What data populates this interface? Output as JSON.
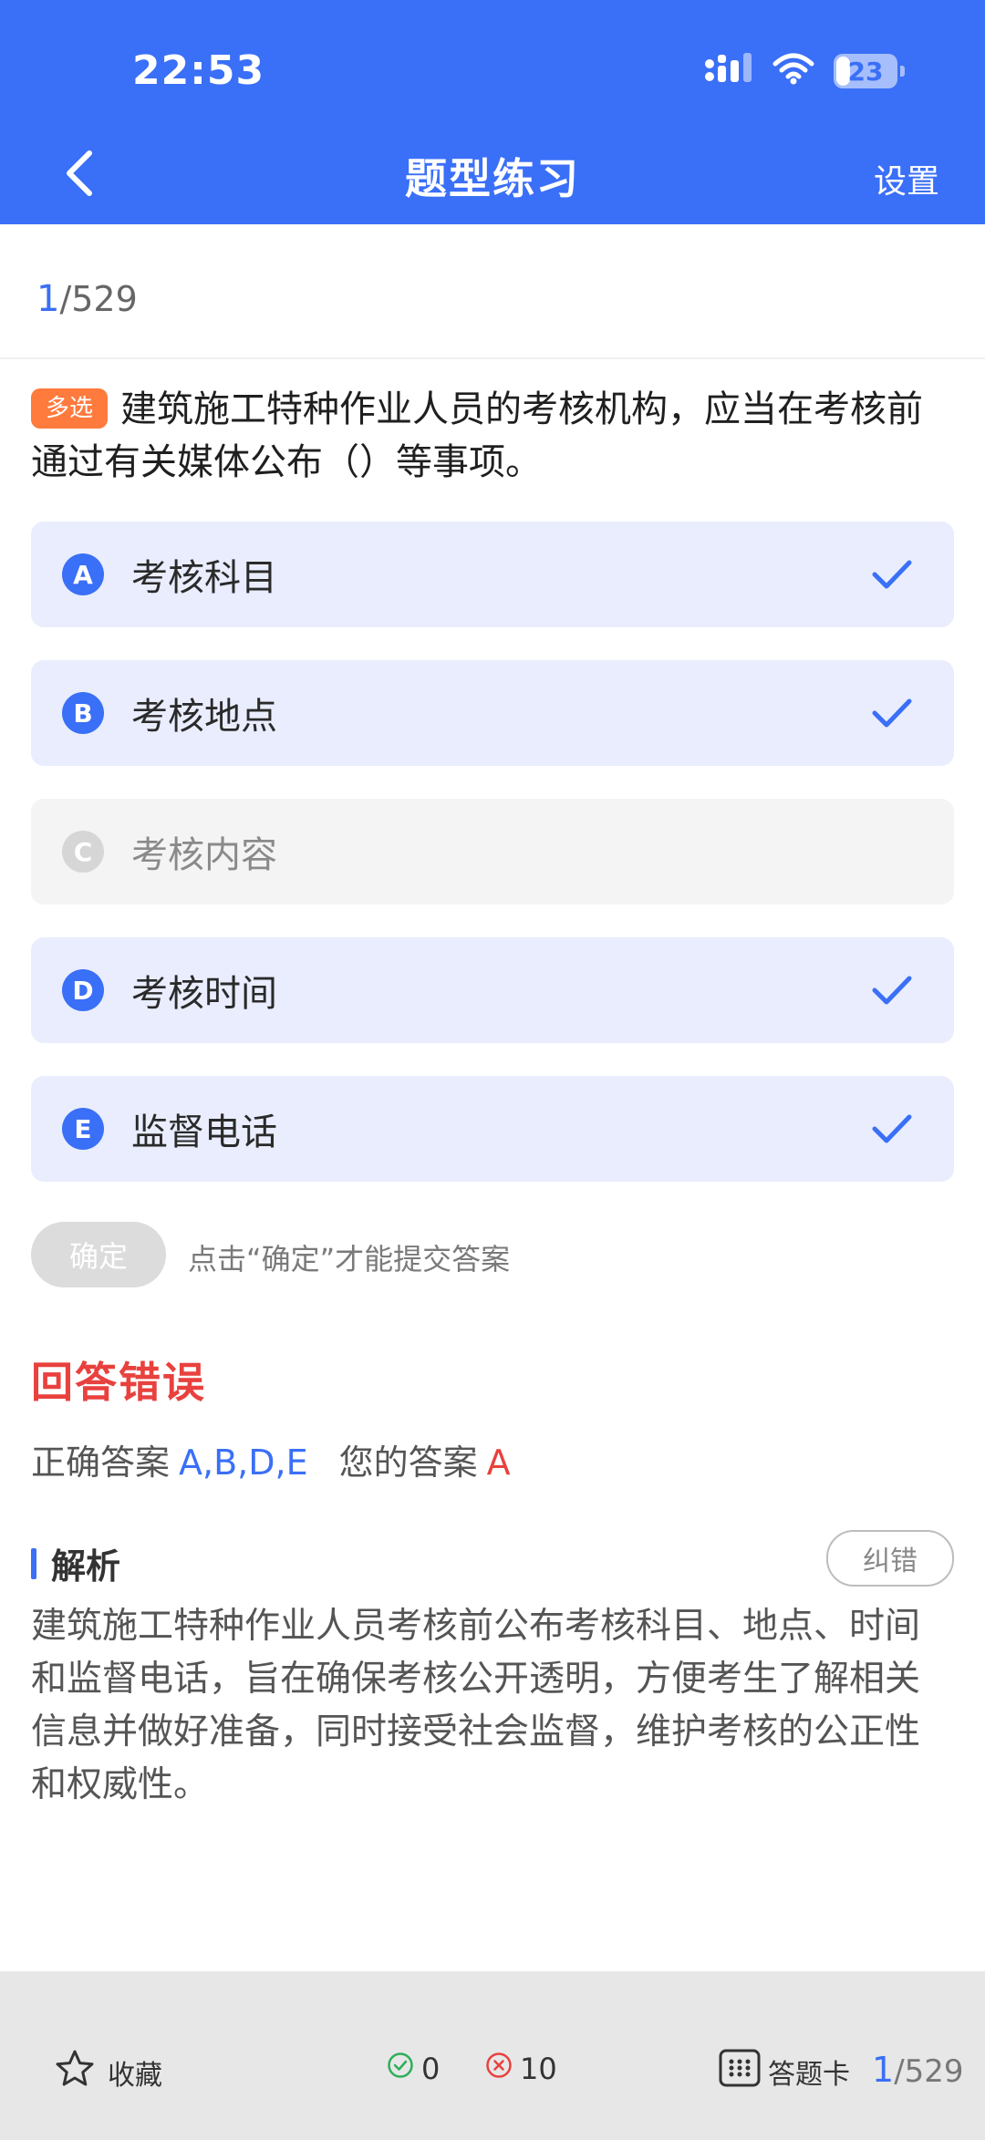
{
  "status_bar": {
    "time": "22:53",
    "battery": "23",
    "battery_level": 0.23
  },
  "nav": {
    "title": "题型练习",
    "settings_label": "设置"
  },
  "progress": {
    "current": "1",
    "total": "/529"
  },
  "question": {
    "type_badge": "多选",
    "text": "建筑施工特种作业人员的考核机构，应当在考核前通过有关媒体公布（）等事项。"
  },
  "options": [
    {
      "letter": "A",
      "text": "考核科目",
      "selected": true
    },
    {
      "letter": "B",
      "text": "考核地点",
      "selected": true
    },
    {
      "letter": "C",
      "text": "考核内容",
      "selected": false
    },
    {
      "letter": "D",
      "text": "考核时间",
      "selected": true
    },
    {
      "letter": "E",
      "text": "监督电话",
      "selected": true
    }
  ],
  "confirm": {
    "button_label": "确定",
    "hint": "点击“确定”才能提交答案"
  },
  "result": {
    "title": "回答错误",
    "correct_label": "正确答案",
    "correct_value": "A,B,D,E",
    "your_label": "您的答案",
    "your_value": "A"
  },
  "analysis": {
    "label": "解析",
    "report_button": "纠错",
    "text": "建筑施工特种作业人员考核前公布考核科目、地点、时间和监督电话，旨在确保考核公开透明，方便考生了解相关信息并做好准备，同时接受社会监督，维护考核的公正性和权威性。"
  },
  "bottom_bar": {
    "favorite_label": "收藏",
    "correct_count": "0",
    "wrong_count": "10",
    "answer_card_label": "答题卡",
    "progress_current": "1",
    "progress_total": "/529"
  },
  "colors": {
    "brand": "#3a6ff7",
    "error": "#e8413e",
    "badge": "#ff7a3d",
    "selected_bg": "#e9edfd",
    "correct_icon": "#2fae5a"
  },
  "icons": {
    "back": "chevron-left-icon",
    "signal": "cellular-signal-icon",
    "wifi": "wifi-icon",
    "battery": "battery-icon",
    "check": "checkmark-icon",
    "favorite": "star-outline-icon",
    "correct": "check-circle-icon",
    "wrong": "x-circle-icon",
    "answer_card": "grid-icon"
  }
}
